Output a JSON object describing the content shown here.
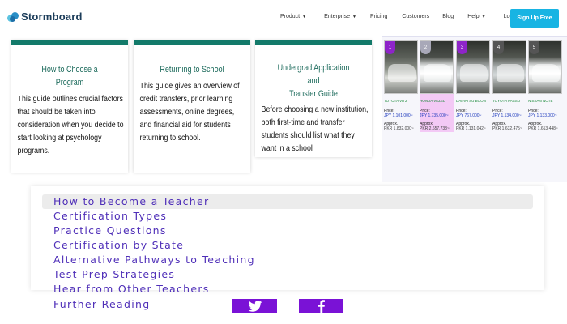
{
  "brand": {
    "name": "Stormboard"
  },
  "nav": {
    "links": [
      {
        "label": "Product",
        "dropdown": true
      },
      {
        "label": "Enterprise",
        "dropdown": true
      },
      {
        "label": "Pricing",
        "dropdown": false
      },
      {
        "label": "Customers",
        "dropdown": false
      },
      {
        "label": "Blog",
        "dropdown": false
      },
      {
        "label": "Help",
        "dropdown": true
      },
      {
        "label": "Login →",
        "dropdown": false
      }
    ],
    "cta": "Sign Up Free"
  },
  "cards": [
    {
      "title": [
        "How to Choose a Program"
      ],
      "text": [
        "This guide outlines crucial factors",
        "that should be taken into",
        "consideration when you decide to",
        "start looking at psychology",
        "programs."
      ]
    },
    {
      "title": [
        "Returning to School"
      ],
      "text": [
        "This guide gives an overview of",
        "credit transfers, prior learning",
        "assessments, online degrees,",
        "and financial aid for students",
        "returning to school."
      ]
    },
    {
      "title": [
        "Undergrad Application and",
        "Transfer Guide"
      ],
      "text": [
        "Before choosing a new institution,",
        "both first-time and transfer",
        "students should list what they",
        "want in a school"
      ]
    }
  ],
  "cars": [
    {
      "rank": "1",
      "name": "TOYOTA VITZ",
      "price_label": "Price:",
      "price": "JPY 1,101,000~",
      "total_label": "Approx.",
      "total": "PKR 1,832,000~",
      "highlight": false,
      "badge_color": "#8e24c9"
    },
    {
      "rank": "2",
      "name": "HONDA VEZEL",
      "price_label": "Price:",
      "price": "JPY 1,735,000~",
      "total_label": "Approx.",
      "total": "PKR 2,657,738~",
      "highlight": true,
      "badge_color": "#a8a8b8"
    },
    {
      "rank": "3",
      "name": "DAIHATSU BOON",
      "price_label": "Price:",
      "price": "JPY 767,000~",
      "total_label": "Approx.",
      "total": "PKR 1,131,042~",
      "highlight": false,
      "badge_color": "#8e24c9"
    },
    {
      "rank": "4",
      "name": "TOYOTA PASSO",
      "price_label": "Price:",
      "price": "JPY 1,134,000~",
      "total_label": "Approx.",
      "total": "PKR 1,632,475~",
      "highlight": false,
      "badge_color": "#555555"
    },
    {
      "rank": "5",
      "name": "NISSAN NOTE",
      "price_label": "Price:",
      "price": "JPY 1,133,000~",
      "total_label": "Approx.",
      "total": "PKR 1,613,448~",
      "highlight": false,
      "badge_color": "#555555"
    }
  ],
  "menu": {
    "items": [
      "How to Become a Teacher",
      "Certification Types",
      "Practice Questions",
      "Certification by State",
      "Alternative Pathways to Teaching",
      "Test Prep Strategies",
      "Hear from Other Teachers",
      "Further Reading"
    ]
  },
  "share": [
    {
      "network": "twitter",
      "icon": "twitter-icon",
      "color": "#7a12d6"
    },
    {
      "network": "facebook",
      "icon": "facebook-icon",
      "color": "#7a12d6"
    }
  ],
  "colors": {
    "accent": "#18b4e3",
    "card_bar": "#137a6a",
    "menu_text": "#4f2fb8",
    "share_bg": "#7a12d6"
  }
}
